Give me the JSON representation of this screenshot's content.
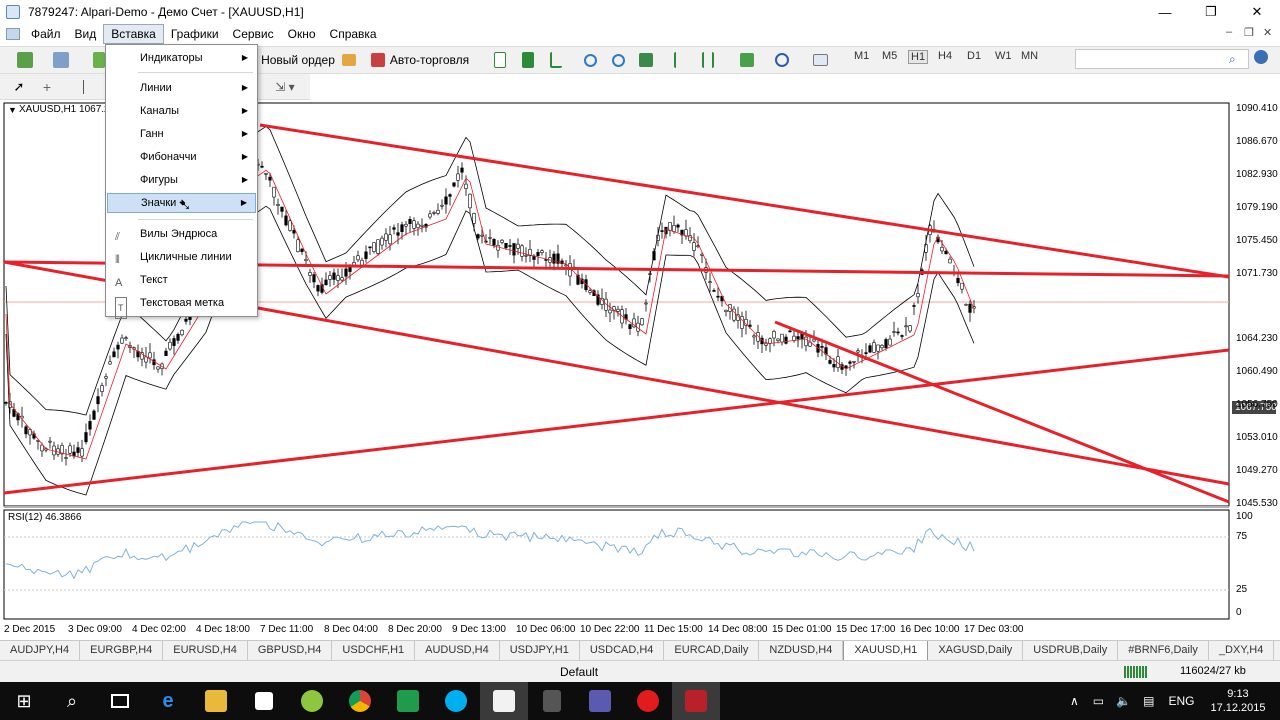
{
  "window": {
    "title": "7879247: Alpari-Demo - Демо Счет - [XAUUSD,H1]",
    "minimize": "—",
    "restore": "❐",
    "close": "✕"
  },
  "menu": [
    "Файл",
    "Вид",
    "Вставка",
    "Графики",
    "Сервис",
    "Окно",
    "Справка"
  ],
  "menu_active": "Вставка",
  "mdi": {
    "minimize": "–",
    "restore": "❐",
    "close": "✕"
  },
  "toolbar": {
    "new_order": "Новый ордер",
    "auto_trading": "Авто-торговля",
    "timeframes": [
      "M1",
      "M5",
      "H1",
      "H4",
      "D1",
      "W1",
      "MN"
    ],
    "selected_timeframe": "H1"
  },
  "dropdown": {
    "submenu_items": [
      "Индикаторы",
      "Линии",
      "Каналы",
      "Ганн",
      "Фибоначчи",
      "Фигуры",
      "Значки"
    ],
    "highlighted": "Значки",
    "tool_items": [
      "Вилы Эндрюса",
      "Цикличные линии",
      "Текст",
      "Текстовая метка"
    ]
  },
  "chart": {
    "symbol_label": "XAUUSD,H1  1067.2",
    "current_price": "1067.750",
    "price_axis": [
      "1090.410",
      "1086.670",
      "1082.930",
      "1079.190",
      "1075.450",
      "1071.730",
      "1067.750",
      "1064.230",
      "1060.490",
      "1056.750",
      "1053.010",
      "1049.270",
      "1045.530"
    ],
    "rsi_label": "RSI(12) 46.3866",
    "rsi_axis": [
      "100",
      "75",
      "25",
      "0"
    ],
    "time_axis": [
      "2 Dec 2015",
      "3 Dec 09:00",
      "4 Dec 02:00",
      "4 Dec 18:00",
      "7 Dec 11:00",
      "8 Dec 04:00",
      "8 Dec 20:00",
      "9 Dec 13:00",
      "10 Dec 06:00",
      "10 Dec 22:00",
      "11 Dec 15:00",
      "14 Dec 08:00",
      "15 Dec 01:00",
      "15 Dec 17:00",
      "16 Dec 10:00",
      "17 Dec 03:00"
    ],
    "colors": {
      "trendline": "#e8202a",
      "bollinger": "#000000",
      "ma": "#e8202a",
      "rsi": "#7fb3d9",
      "price_line": "#f4a7a0"
    }
  },
  "tabs": [
    "AUDJPY,H4",
    "EURGBP,H4",
    "EURUSD,H4",
    "GBPUSD,H4",
    "USDCHF,H1",
    "AUDUSD,H4",
    "USDJPY,H1",
    "USDCAD,H4",
    "EURCAD,Daily",
    "NZDUSD,H4",
    "XAUUSD,H1",
    "XAGUSD,Daily",
    "USDRUB,Daily",
    "#BRNF6,Daily",
    "_DXY,H4",
    "EUR"
  ],
  "active_tab": "XAUUSD,H1",
  "status": {
    "profile": "Default",
    "traffic": "116024/27 kb"
  },
  "taskbar": {
    "language": "ENG",
    "time": "9:13",
    "date": "17.12.2015"
  }
}
